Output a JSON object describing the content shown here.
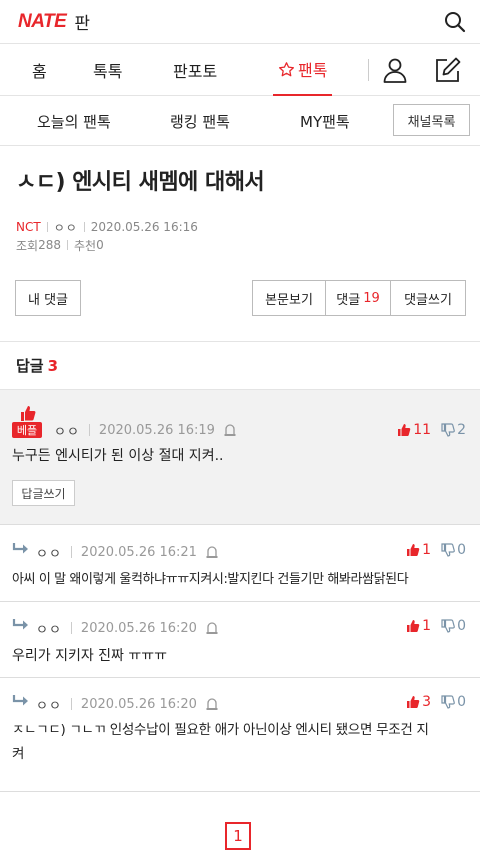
{
  "header": {
    "logo_text": "NATE",
    "logo_sub": "판",
    "search_icon": "search-icon"
  },
  "nav": {
    "items": [
      {
        "label": "홈"
      },
      {
        "label": "톡톡"
      },
      {
        "label": "판포토"
      },
      {
        "label": "팬톡",
        "active": true
      }
    ]
  },
  "subnav": {
    "items": [
      {
        "label": "오늘의 팬톡"
      },
      {
        "label": "랭킹 팬톡"
      },
      {
        "label": "MY팬톡"
      }
    ],
    "channel_button": "채널목록"
  },
  "post": {
    "title": "ㅅㄷ) 엔시티 새멤에 대해서",
    "category": "NCT",
    "author": "ㅇㅇ",
    "datetime": "2020.05.26 16:16",
    "views_label": "조회",
    "views": "288",
    "recommend_label": "추천",
    "recommend": "0"
  },
  "actions": {
    "my_comments": "내 댓글",
    "view_body": "본문보기",
    "comments_label": "댓글",
    "comments_count": "19",
    "write_comment": "댓글쓰기"
  },
  "replies": {
    "label": "답글",
    "count": "3",
    "best": {
      "badge": "베플",
      "author": "ㅇㅇ",
      "datetime": "2020.05.26 16:19",
      "up": "11",
      "down": "2",
      "text": "누구든 엔시티가 된 이상 절대 지켜..",
      "reply_button": "답글쓰기"
    },
    "items": [
      {
        "author": "ㅇㅇ",
        "datetime": "2020.05.26 16:21",
        "up": "1",
        "down": "0",
        "text": "아씨 이 말 왜이렇게 울컥하냐ㅠㅠ지켜시:발지킨다 건들기만 해봐라쌈닭된다"
      },
      {
        "author": "ㅇㅇ",
        "datetime": "2020.05.26 16:20",
        "up": "1",
        "down": "0",
        "text": "우리가 지키자 진짜 ㅠㅠㅠ"
      },
      {
        "author": "ㅇㅇ",
        "datetime": "2020.05.26 16:20",
        "up": "3",
        "down": "0",
        "text_line1": "ㅈㄴㄱㄷ) ㄱㄴㄲ 인성수납이 필요한 애가 아닌이상 엔시티 됐으면 무조건 지",
        "text_line2": "켜"
      }
    ]
  },
  "pagination": {
    "current": "1"
  },
  "colors": {
    "accent": "#e8262b",
    "downvote": "#7a93a8"
  }
}
